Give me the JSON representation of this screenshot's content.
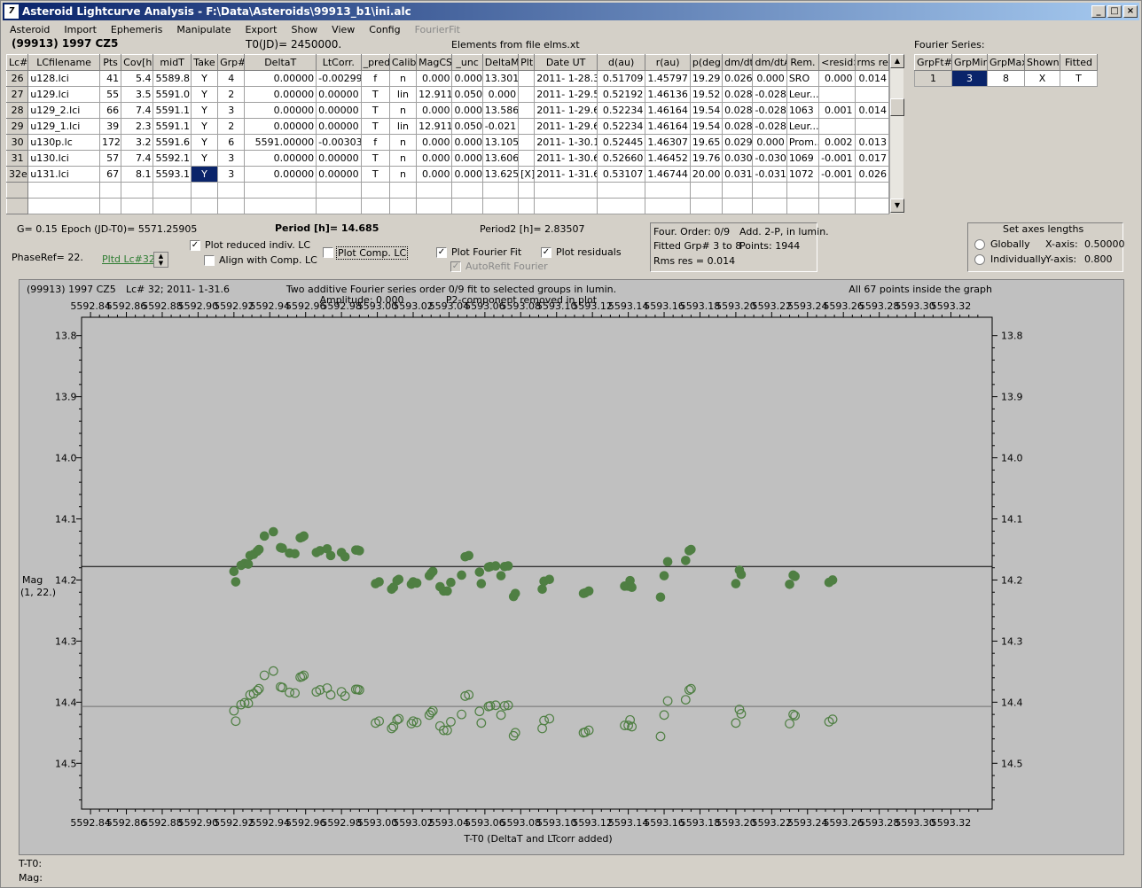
{
  "window": {
    "title": "Asteroid Lightcurve Analysis - F:\\Data\\Asteroids\\99913_b1\\ini.alc",
    "min": "_",
    "max": "□",
    "close": "×"
  },
  "menu": [
    {
      "label": "Asteroid",
      "disabled": false
    },
    {
      "label": "Import",
      "disabled": false
    },
    {
      "label": "Ephemeris",
      "disabled": false
    },
    {
      "label": "Manipulate",
      "disabled": false
    },
    {
      "label": "Export",
      "disabled": false
    },
    {
      "label": "Show",
      "disabled": false
    },
    {
      "label": "View",
      "disabled": false
    },
    {
      "label": "Config",
      "disabled": false
    },
    {
      "label": "FourierFit",
      "disabled": true
    }
  ],
  "header": {
    "asteroid": "(99913) 1997 CZ5",
    "t0": "T0(JD)= 2450000.",
    "elements": "Elements from file elms.xt"
  },
  "lc_table": {
    "columns": [
      "Lc#",
      "LCfilename",
      "Pts",
      "Cov[h]",
      "midT",
      "Take",
      "Grp#",
      "DeltaT",
      "LtCorr.",
      "_pred.",
      "Calib.",
      "MagCS",
      "_unc",
      "DeltaM",
      "Plt",
      "Date UT",
      "d(au)",
      "r(au)",
      "p(deg)",
      "dm/dt",
      "dm/dtA",
      "Rem.",
      "<resid>",
      "rms res"
    ],
    "rows": [
      [
        "26",
        "u128.lci",
        "41",
        "5.4",
        "5589.8",
        "Y",
        "4",
        "0.00000",
        "-0.00299",
        "f",
        "n",
        "0.000",
        "0.000",
        "13.301",
        "",
        "2011- 1-28.3",
        "0.51709",
        "1.45797",
        "19.29",
        "0.026",
        "0.000",
        "SRO",
        "0.000",
        "0.014"
      ],
      [
        "27",
        "u129.lci",
        "55",
        "3.5",
        "5591.0",
        "Y",
        "2",
        "0.00000",
        "0.00000",
        "T",
        "lin",
        "12.911",
        "0.050",
        "0.000",
        "",
        "2011- 1-29.5",
        "0.52192",
        "1.46136",
        "19.52",
        "0.028",
        "-0.028",
        "Leur...",
        "",
        ""
      ],
      [
        "28",
        "u129_2.lci",
        "66",
        "7.4",
        "5591.1",
        "Y",
        "3",
        "0.00000",
        "0.00000",
        "T",
        "n",
        "0.000",
        "0.000",
        "13.586",
        "",
        "2011- 1-29.6",
        "0.52234",
        "1.46164",
        "19.54",
        "0.028",
        "-0.028",
        "1063",
        "0.001",
        "0.014"
      ],
      [
        "29",
        "u129_1.lci",
        "39",
        "2.3",
        "5591.1",
        "Y",
        "2",
        "0.00000",
        "0.00000",
        "T",
        "lin",
        "12.911",
        "0.050",
        "-0.021",
        "",
        "2011- 1-29.6",
        "0.52234",
        "1.46164",
        "19.54",
        "0.028",
        "-0.028",
        "Leur...",
        "",
        ""
      ],
      [
        "30",
        "u130p.lc",
        "172",
        "3.2",
        "5591.6",
        "Y",
        "6",
        "5591.00000",
        "-0.00303",
        "f",
        "n",
        "0.000",
        "0.000",
        "13.105",
        "",
        "2011- 1-30.1",
        "0.52445",
        "1.46307",
        "19.65",
        "0.029",
        "0.000",
        "Prom...",
        "0.002",
        "0.013"
      ],
      [
        "31",
        "u130.lci",
        "57",
        "7.4",
        "5592.1",
        "Y",
        "3",
        "0.00000",
        "0.00000",
        "T",
        "n",
        "0.000",
        "0.000",
        "13.606",
        "",
        "2011- 1-30.6",
        "0.52660",
        "1.46452",
        "19.76",
        "0.030",
        "-0.030",
        "1069",
        "-0.001",
        "0.017"
      ],
      [
        "32e",
        "u131.lci",
        "67",
        "8.1",
        "5593.1",
        "Y",
        "3",
        "0.00000",
        "0.00000",
        "T",
        "n",
        "0.000",
        "0.000",
        "13.625",
        "[X]",
        "2011- 1-31.6",
        "0.53107",
        "1.46744",
        "20.00",
        "0.031",
        "-0.031",
        "1072",
        "-0.001",
        "0.026"
      ]
    ]
  },
  "fourier_table": {
    "title": "Fourier Series:",
    "columns": [
      "GrpFt#",
      "GrpMin",
      "GrpMax",
      "Shown",
      "Fitted"
    ],
    "row": [
      "1",
      "3",
      "8",
      "X",
      "T"
    ]
  },
  "info": {
    "g": "G= 0.15",
    "epoch": "Epoch (JD-T0)= 5571.25905",
    "period": "Period [h]= 14.685",
    "period2": "Period2 [h]= 2.83507",
    "phase_ref": "PhaseRef= 22.",
    "plotted_lc": "Pltd Lc#32:",
    "chk_reduced": "Plot reduced indiv. LC",
    "chk_align": "Align with Comp. LC",
    "chk_comp": "Plot Comp. LC",
    "chk_fourier": "Plot Fourier Fit",
    "chk_autorefit": "AutoRefit Fourier",
    "chk_resid": "Plot residuals",
    "four_order": "Four. Order:  0/9",
    "add2p": "Add. 2-P, in lumin.",
    "fitted_grp": "Fitted Grp# 3 to 8",
    "points": "Points: 1944",
    "rms": "Rms res      = 0.014",
    "axes_title": "Set axes lengths",
    "globally": "Globally",
    "individually": "Individually",
    "xaxis_label": "X-axis:",
    "xaxis_val": "0.50000",
    "yaxis_label": "Y-axis:",
    "yaxis_val": "0.800"
  },
  "plot": {
    "top_left": "(99913) 1997 CZ5",
    "lc_info": "Lc# 32; 2011- 1-31.6",
    "desc1": "Two additive Fourier series order 0/9 fit to selected groups in lumin.",
    "desc2": "Amplitude: 0.000",
    "desc3": "P2-component removed in plot",
    "points_inside": "All 67 points inside the graph",
    "ylabel1": "Mag",
    "ylabel2": "(1, 22.)",
    "xlabel": "T-T0 (DeltaT and LTcorr added)"
  },
  "chart_data": {
    "type": "scatter",
    "xlim": [
      5592.835,
      5593.343
    ],
    "ylim": [
      13.77,
      14.575
    ],
    "xticks": [
      "5592.84",
      "5592.86",
      "5592.88",
      "5592.90",
      "5592.92",
      "5592.94",
      "5592.96",
      "5592.98",
      "5593.00",
      "5593.02",
      "5593.04",
      "5593.06",
      "5593.08",
      "5593.10",
      "5593.12",
      "5593.14",
      "5593.16",
      "5593.18",
      "5593.20",
      "5593.22",
      "5593.24",
      "5593.26",
      "5593.28",
      "5593.30",
      "5593.32"
    ],
    "yticks": [
      "13.8",
      "13.9",
      "14.0",
      "14.1",
      "14.2",
      "14.3",
      "14.4",
      "14.5"
    ],
    "fit_line": 14.178,
    "resid_line": 14.407,
    "series": [
      {
        "color": "#4f7f43",
        "x": [
          5592.92,
          5592.921,
          5592.924,
          5592.926,
          5592.928,
          5592.929,
          5592.931,
          5592.933,
          5592.934,
          5592.937,
          5592.942,
          5592.946,
          5592.947,
          5592.951,
          5592.954,
          5592.957,
          5592.958,
          5592.959,
          5592.966,
          5592.968,
          5592.972,
          5592.974,
          5592.98,
          5592.982,
          5592.988,
          5592.989,
          5592.99,
          5592.999,
          5593.001,
          5593.008,
          5593.009,
          5593.011,
          5593.012,
          5593.019,
          5593.02,
          5593.022,
          5593.029,
          5593.03,
          5593.031,
          5593.035,
          5593.037,
          5593.039,
          5593.041,
          5593.047,
          5593.049,
          5593.051,
          5593.057,
          5593.058,
          5593.062,
          5593.063,
          5593.066,
          5593.069,
          5593.071,
          5593.073,
          5593.076,
          5593.077,
          5593.092,
          5593.093,
          5593.096,
          5593.115,
          5593.116,
          5593.118,
          5593.138,
          5593.14,
          5593.141,
          5593.142,
          5593.158,
          5593.16,
          5593.162,
          5593.172,
          5593.174,
          5593.175,
          5593.2,
          5593.202,
          5593.203,
          5593.23,
          5593.232,
          5593.233,
          5593.252,
          5593.254
        ],
        "y": [
          14.186,
          14.203,
          14.176,
          14.173,
          14.174,
          14.16,
          14.158,
          14.153,
          14.15,
          14.128,
          14.121,
          14.147,
          14.148,
          14.156,
          14.157,
          14.131,
          14.13,
          14.128,
          14.155,
          14.152,
          14.149,
          14.16,
          14.155,
          14.162,
          14.151,
          14.151,
          14.152,
          14.206,
          14.203,
          14.215,
          14.212,
          14.201,
          14.199,
          14.207,
          14.203,
          14.205,
          14.193,
          14.189,
          14.186,
          14.211,
          14.218,
          14.218,
          14.204,
          14.192,
          14.162,
          14.16,
          14.187,
          14.206,
          14.179,
          14.178,
          14.177,
          14.193,
          14.178,
          14.177,
          14.227,
          14.222,
          14.215,
          14.202,
          14.199,
          14.222,
          14.221,
          14.218,
          14.21,
          14.21,
          14.201,
          14.212,
          14.228,
          14.193,
          14.17,
          14.168,
          14.152,
          14.15,
          14.206,
          14.184,
          14.191,
          14.207,
          14.192,
          14.194,
          14.204,
          14.2
        ]
      },
      {
        "color": "#4f7f43",
        "hollow": true,
        "x": [
          5592.92,
          5592.921,
          5592.924,
          5592.926,
          5592.928,
          5592.929,
          5592.931,
          5592.933,
          5592.934,
          5592.937,
          5592.942,
          5592.946,
          5592.947,
          5592.951,
          5592.954,
          5592.957,
          5592.958,
          5592.959,
          5592.966,
          5592.968,
          5592.972,
          5592.974,
          5592.98,
          5592.982,
          5592.988,
          5592.989,
          5592.99,
          5592.999,
          5593.001,
          5593.008,
          5593.009,
          5593.011,
          5593.012,
          5593.019,
          5593.02,
          5593.022,
          5593.029,
          5593.03,
          5593.031,
          5593.035,
          5593.037,
          5593.039,
          5593.041,
          5593.047,
          5593.049,
          5593.051,
          5593.057,
          5593.058,
          5593.062,
          5593.063,
          5593.066,
          5593.069,
          5593.071,
          5593.073,
          5593.076,
          5593.077,
          5593.092,
          5593.093,
          5593.096,
          5593.115,
          5593.116,
          5593.118,
          5593.138,
          5593.14,
          5593.141,
          5593.142,
          5593.158,
          5593.16,
          5593.162,
          5593.172,
          5593.174,
          5593.175,
          5593.2,
          5593.202,
          5593.203,
          5593.23,
          5593.232,
          5593.233,
          5593.252,
          5593.254
        ],
        "y": [
          14.414,
          14.431,
          14.404,
          14.401,
          14.402,
          14.388,
          14.386,
          14.381,
          14.378,
          14.356,
          14.349,
          14.375,
          14.376,
          14.384,
          14.385,
          14.359,
          14.358,
          14.356,
          14.383,
          14.38,
          14.377,
          14.388,
          14.383,
          14.39,
          14.379,
          14.379,
          14.38,
          14.434,
          14.431,
          14.443,
          14.44,
          14.429,
          14.427,
          14.435,
          14.431,
          14.433,
          14.421,
          14.417,
          14.414,
          14.439,
          14.446,
          14.446,
          14.432,
          14.42,
          14.39,
          14.388,
          14.415,
          14.434,
          14.407,
          14.406,
          14.405,
          14.421,
          14.406,
          14.405,
          14.455,
          14.45,
          14.443,
          14.43,
          14.427,
          14.45,
          14.449,
          14.446,
          14.438,
          14.438,
          14.429,
          14.44,
          14.456,
          14.421,
          14.398,
          14.396,
          14.38,
          14.378,
          14.434,
          14.412,
          14.419,
          14.435,
          14.42,
          14.422,
          14.432,
          14.428
        ]
      }
    ]
  },
  "status": {
    "t_t0": "T-T0:",
    "mag": "Mag:"
  }
}
